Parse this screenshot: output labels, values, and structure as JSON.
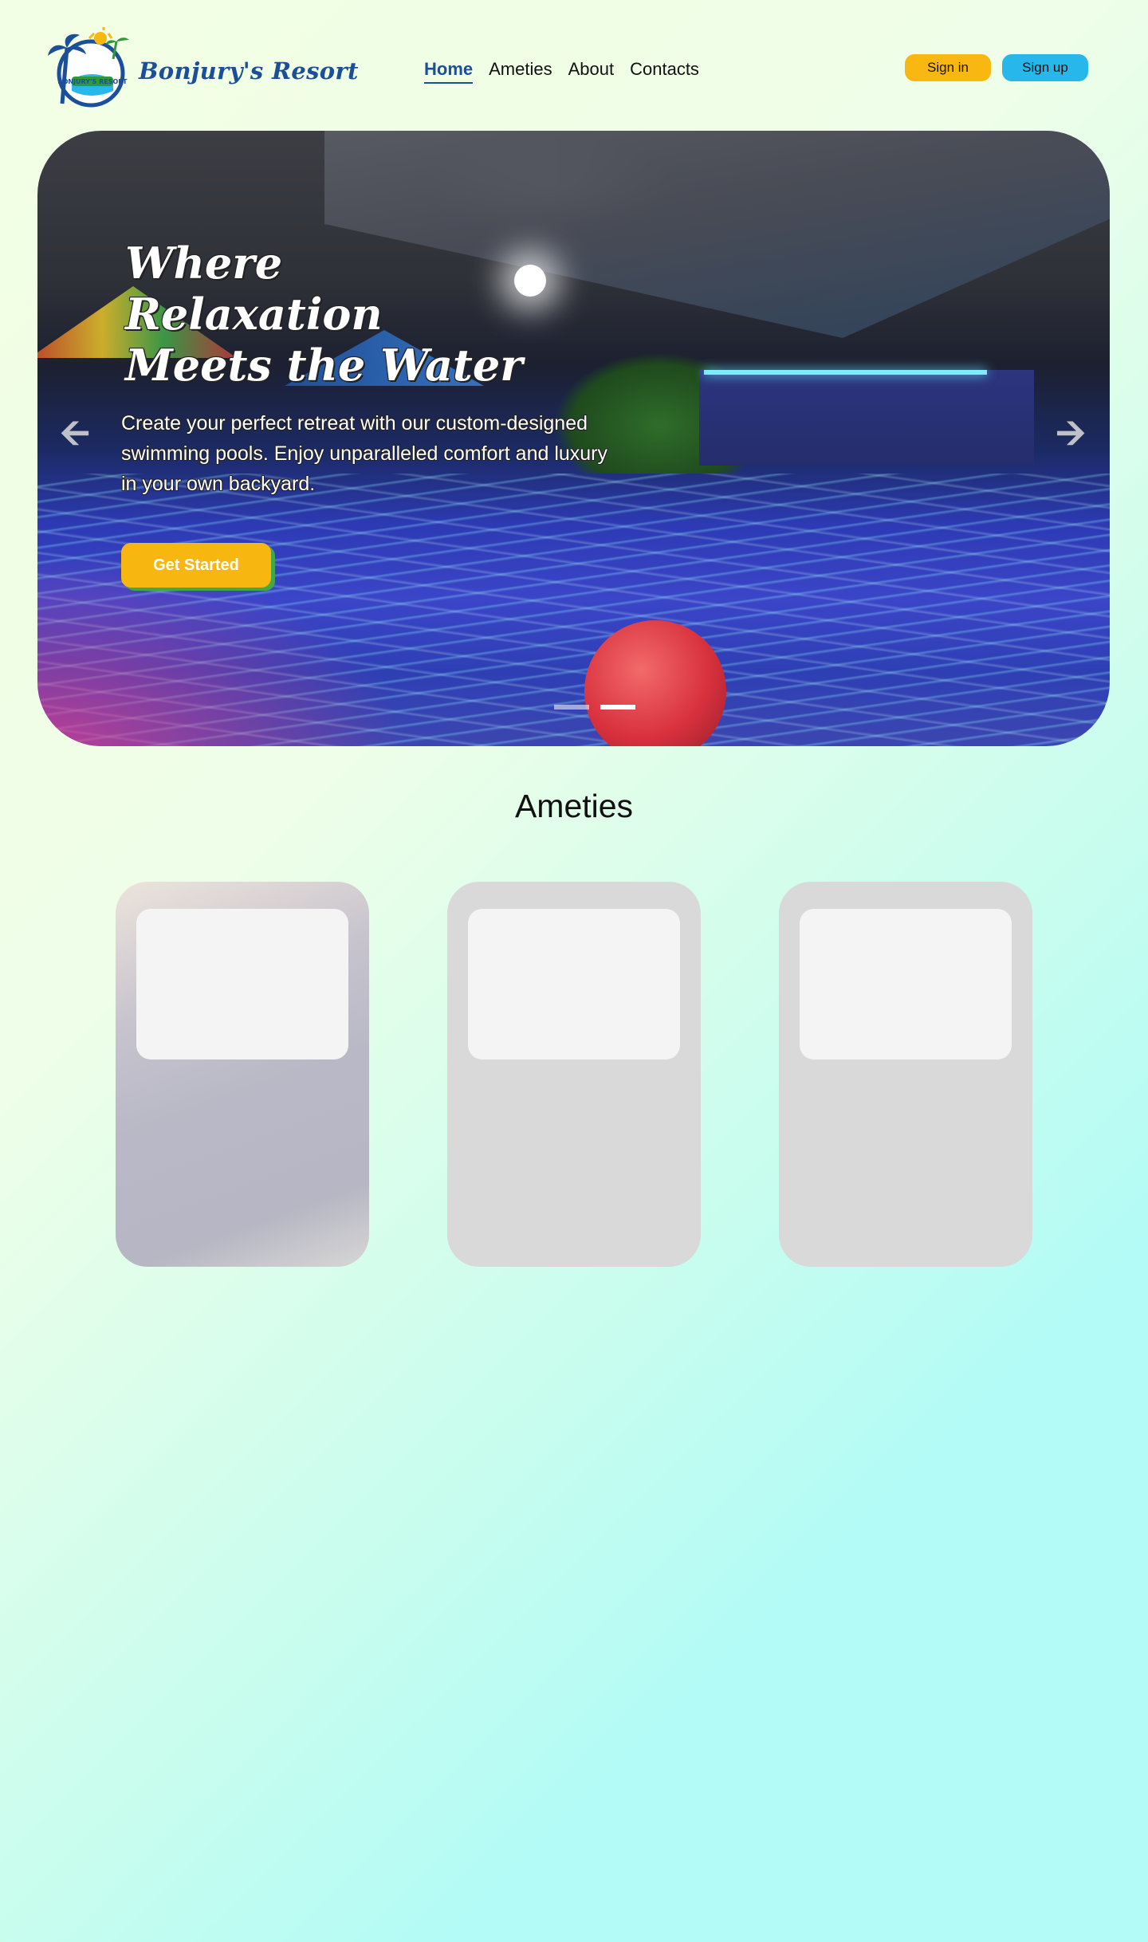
{
  "header": {
    "brand": "Bonjury's Resort",
    "logo_text": "BONJURY'S RESORT",
    "nav": [
      {
        "label": "Home",
        "active": true
      },
      {
        "label": "Ameties",
        "active": false
      },
      {
        "label": "About",
        "active": false
      },
      {
        "label": "Contacts",
        "active": false
      }
    ],
    "signin_label": "Sign in",
    "signup_label": "Sign up"
  },
  "hero": {
    "title": "Where\nRelaxation\nMeets the Water",
    "subtitle": "Create your perfect retreat with our custom-designed swimming pools. Enjoy unparalleled comfort and luxury in your own backyard.",
    "cta_label": "Get Started",
    "prev_icon": "arrow-left-icon",
    "next_icon": "arrow-right-icon",
    "slide_count": 2,
    "active_slide": 2
  },
  "amenities": {
    "title": "Ameties",
    "card_count": 3
  },
  "colors": {
    "brand_blue": "#1b4f98",
    "signin_yellow": "#f9b712",
    "signup_cyan": "#27b7ea",
    "cta_yellow": "#f8b611",
    "cta_shadow_green": "#3fa94a"
  }
}
